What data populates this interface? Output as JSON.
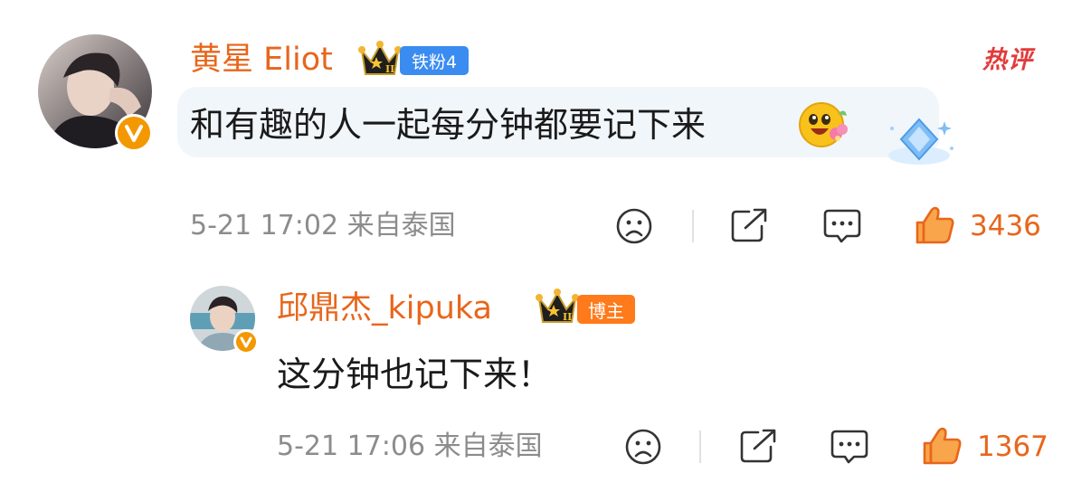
{
  "hot_label": "热评",
  "colors": {
    "username": "#e8661b",
    "like_active": "#e8661b",
    "tier_tag": "#3b8cf0",
    "blogger_tag": "#ff7a1a",
    "verified_badge": "#f39800",
    "hot_label": "#e23b3b",
    "meta_text": "#8c8c8c"
  },
  "comment": {
    "username": "黄星 Eliot",
    "badge_icon": "crown-level-II-icon",
    "tag": "铁粉4",
    "text": "和有趣的人一起每分钟都要记下来",
    "emoji": "flower-face-emoji-icon",
    "sticker": "blue-diamond-icon",
    "meta": "5-21 17:02  来自泰国",
    "likes": "3436"
  },
  "reply": {
    "username": "邱鼎杰_kipuka",
    "badge_icon": "crown-level-II-icon",
    "tag": "博主",
    "text": "这分钟也记下来！",
    "meta": "5-21 17:06  来自泰国",
    "likes": "1367"
  }
}
